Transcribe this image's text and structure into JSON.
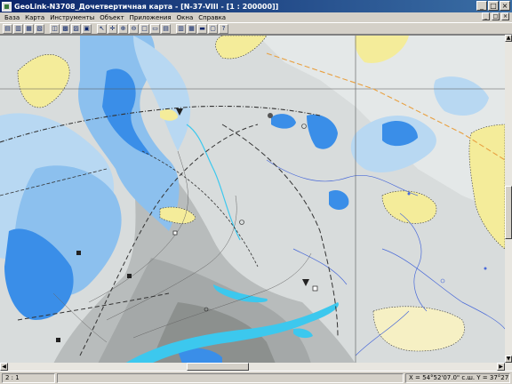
{
  "window": {
    "title": "GeoLink-N3708_Дочетвертичная карта - [N-37-VIII - [1 : 200000]]",
    "controls": {
      "minimize": "_",
      "maximize": "□",
      "close": "×"
    }
  },
  "menu": {
    "items": [
      "База",
      "Карта",
      "Инструменты",
      "Объект",
      "Приложения",
      "Окна",
      "Справка"
    ],
    "child_controls": {
      "minimize": "_",
      "maximize": "□",
      "close": "×"
    }
  },
  "toolbar": {
    "buttons": [
      {
        "icon": "layers-icon",
        "glyph": "▤"
      },
      {
        "icon": "open-icon",
        "glyph": "▥"
      },
      {
        "icon": "open-multi-icon",
        "glyph": "▦"
      },
      {
        "icon": "copy-icon",
        "glyph": "▧"
      },
      {
        "icon": "view-icon",
        "glyph": "◫"
      },
      {
        "icon": "layer-settings-icon",
        "glyph": "▩"
      },
      {
        "icon": "objects-icon",
        "glyph": "▨"
      },
      {
        "icon": "legend-icon",
        "glyph": "▣"
      },
      {
        "icon": "pointer-icon",
        "glyph": "↖"
      },
      {
        "icon": "cross-icon",
        "glyph": "✛"
      },
      {
        "icon": "zoom-in-icon",
        "glyph": "⊕"
      },
      {
        "icon": "zoom-out-icon",
        "glyph": "⊖"
      },
      {
        "icon": "zoom-area-icon",
        "glyph": "□"
      },
      {
        "icon": "measure-icon",
        "glyph": "▭"
      },
      {
        "icon": "table-icon",
        "glyph": "▤"
      },
      {
        "icon": "report-icon",
        "glyph": "▥"
      },
      {
        "icon": "grid-icon",
        "glyph": "▦"
      },
      {
        "icon": "print-icon",
        "glyph": "▬"
      },
      {
        "icon": "window-icon",
        "glyph": "▢"
      },
      {
        "icon": "help-icon",
        "glyph": "?"
      }
    ]
  },
  "status": {
    "scale": "2 : 1",
    "coordinates": "X = 54°52'07.0\" с.ш.  Y = 37°27'13.0\" в.д."
  },
  "colors": {
    "lake_blue": "#3a8ee8",
    "valley_blue": "#8cc0ee",
    "pale_blue": "#b8d8f2",
    "sand_yellow": "#f4ec9a",
    "river_cyan": "#3cc8ee",
    "terrain_gray": "#c8cccc",
    "terrain_dark": "#a8aca8",
    "boundary_orange": "#e8a040"
  }
}
